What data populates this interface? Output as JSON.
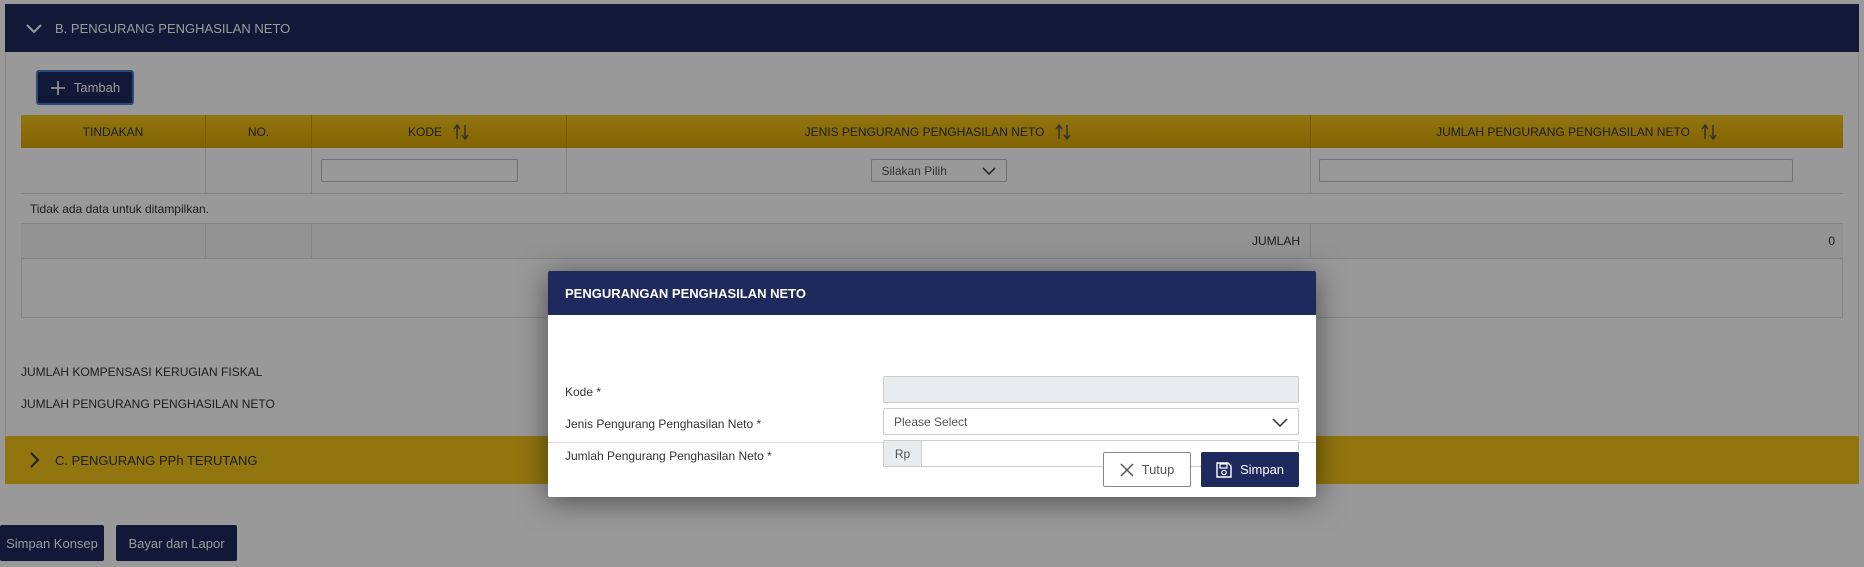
{
  "section_b": {
    "title": "B. PENGURANG PENGHASILAN NETO",
    "add_label": "Tambah",
    "table": {
      "headers": [
        "TINDAKAN",
        "NO.",
        "KODE",
        "JENIS PENGURANG PENGHASILAN NETO",
        "JUMLAH PENGURANG PENGHASILAN NETO"
      ],
      "filter_select_value": "Silakan Pilih",
      "no_data": "Tidak ada data untuk ditampilkan.",
      "sum_label": "JUMLAH",
      "sum_value": "0"
    },
    "summary_1": "JUMLAH KOMPENSASI KERUGIAN FISKAL",
    "summary_2": "JUMLAH PENGURANG PENGHASILAN NETO"
  },
  "section_c": {
    "title": "C. PENGURANG PPh TERUTANG"
  },
  "footer": {
    "save_draft": "Simpan Konsep",
    "pay_report": "Bayar dan Lapor"
  },
  "modal": {
    "title": "PENGURANGAN PENGHASILAN NETO",
    "kode_label": "Kode *",
    "jenis_label": "Jenis Pengurang Penghasilan Neto *",
    "jenis_value": "Please Select",
    "jumlah_label": "Jumlah Pengurang Penghasilan Neto *",
    "currency": "Rp",
    "close_label": "Tutup",
    "save_label": "Simpan"
  },
  "colors": {
    "navy": "#1e2a5e",
    "gold": "#f2c41a"
  }
}
